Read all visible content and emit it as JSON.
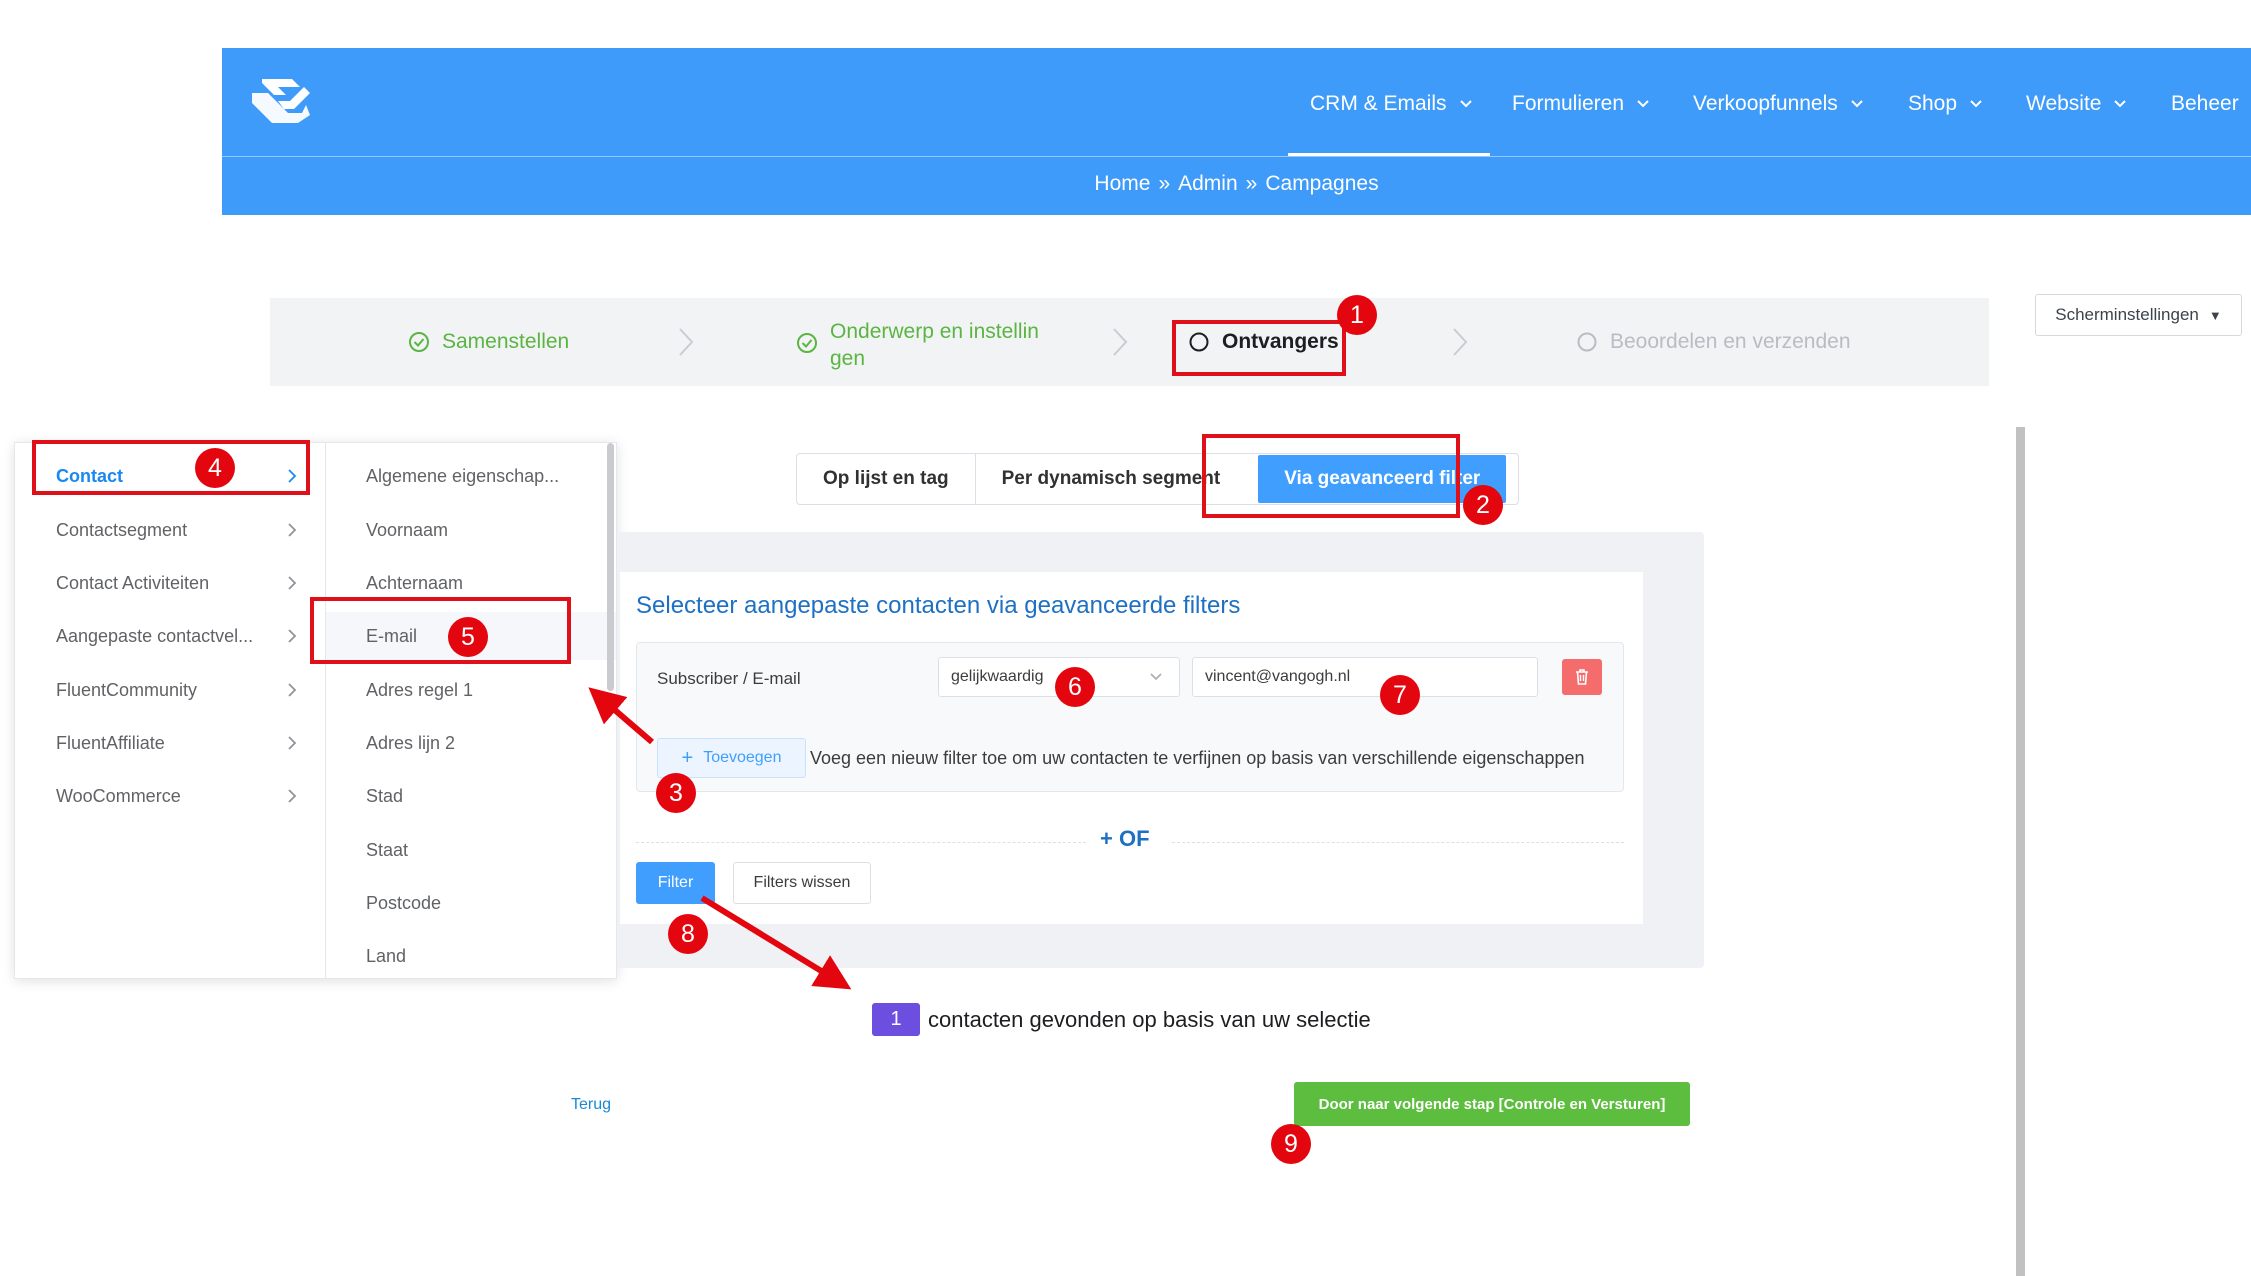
{
  "nav": {
    "items": [
      {
        "label": "CRM & Emails"
      },
      {
        "label": "Formulieren"
      },
      {
        "label": "Verkoopfunnels"
      },
      {
        "label": "Shop"
      },
      {
        "label": "Website"
      },
      {
        "label": "Beheer"
      }
    ],
    "breadcrumb": [
      "Home",
      "»",
      "Admin",
      "»",
      "Campagnes"
    ]
  },
  "stepper": {
    "steps": [
      {
        "label": "Samenstellen",
        "state": "done"
      },
      {
        "label_line1": "Onderwerp en instellin",
        "label_line2": "gen",
        "state": "done"
      },
      {
        "label": "Ontvangers",
        "state": "active"
      },
      {
        "label": "Beoordelen en verzenden",
        "state": "todo"
      }
    ]
  },
  "screen_settings": {
    "label": "Scherminstellingen"
  },
  "cascader": {
    "categories": [
      {
        "label": "Contact"
      },
      {
        "label": "Contactsegment"
      },
      {
        "label": "Contact Activiteiten"
      },
      {
        "label": "Aangepaste contactvel..."
      },
      {
        "label": "FluentCommunity"
      },
      {
        "label": "FluentAffiliate"
      },
      {
        "label": "WooCommerce"
      }
    ],
    "fields": [
      {
        "label": "Algemene eigenschap..."
      },
      {
        "label": "Voornaam"
      },
      {
        "label": "Achternaam"
      },
      {
        "label": "E-mail"
      },
      {
        "label": "Adres regel 1"
      },
      {
        "label": "Adres lijn 2"
      },
      {
        "label": "Stad"
      },
      {
        "label": "Staat"
      },
      {
        "label": "Postcode"
      },
      {
        "label": "Land"
      }
    ]
  },
  "tabs": [
    {
      "label": "Op lijst en tag"
    },
    {
      "label": "Per dynamisch segment"
    },
    {
      "label": "Via geavanceerd filter"
    }
  ],
  "filter": {
    "title": "Selecteer aangepaste contacten via geavanceerde filters",
    "field_label": "Subscriber / E-mail",
    "operator": "gelijkwaardig",
    "value": "vincent@vangogh.nl",
    "add_label": "Toevoegen",
    "add_hint": "Voeg een nieuw filter toe om uw contacten te verfijnen op basis van verschillende eigenschappen",
    "or_label": "+ OF",
    "filter_button": "Filter",
    "clear_button": "Filters wissen"
  },
  "result": {
    "count": "1",
    "text": "contacten gevonden op basis van uw selectie"
  },
  "footer": {
    "back_label": "Terug",
    "next_label": "Door naar volgende stap [Controle en Versturen]"
  },
  "annotations": {
    "badges": [
      "1",
      "2",
      "3",
      "4",
      "5",
      "6",
      "7",
      "8",
      "9"
    ],
    "color": "#e3060e"
  },
  "colors": {
    "brand_blue": "#3e9bf9",
    "primary": "#409eff",
    "success": "#5cbd3e",
    "danger": "#f56c6c",
    "count_badge": "#6d4fe0"
  }
}
